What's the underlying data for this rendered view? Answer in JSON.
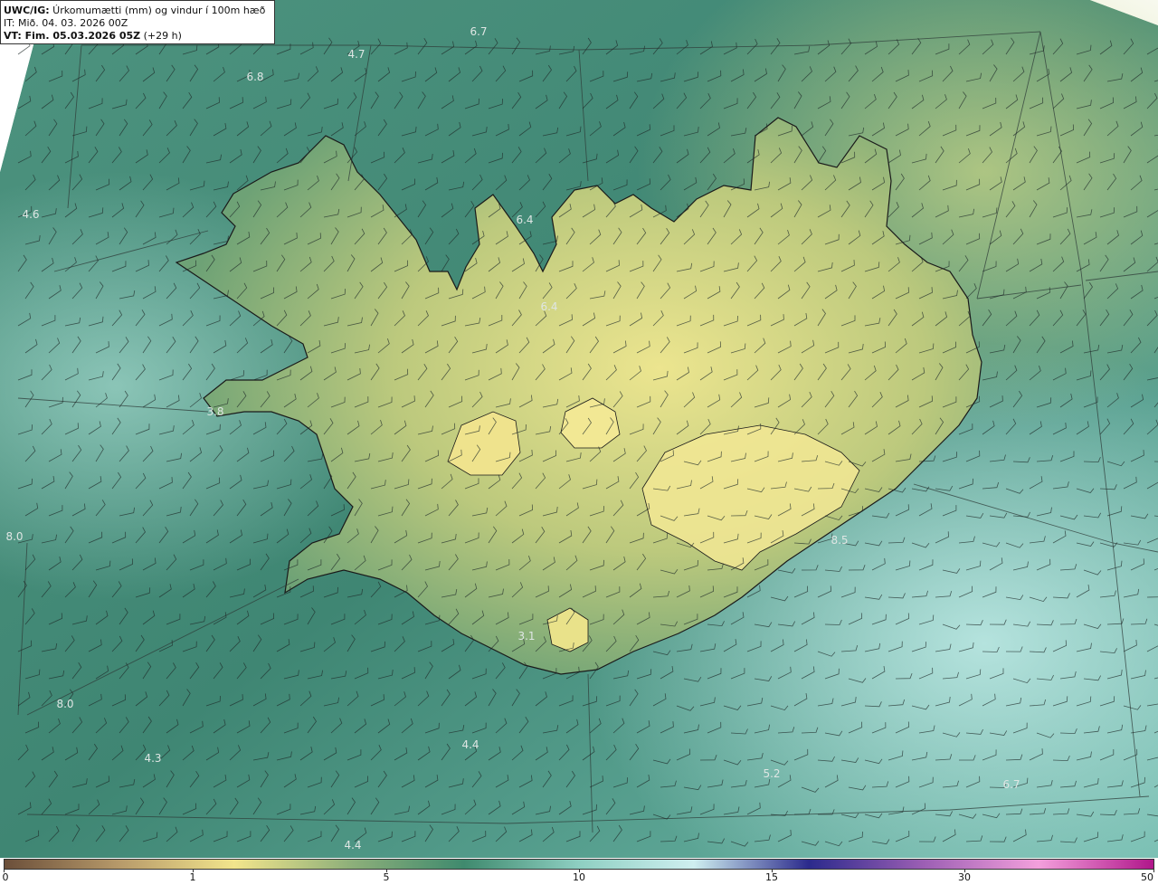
{
  "header": {
    "product_bold": "UWC/IG:",
    "product_text": " Úrkomumætti (mm) og vindur í 100m hæð",
    "init_text": "IT: Mið. 04. 03. 2026 00Z",
    "valid_bold": "VT: Fim. 05.03.2026 05Z",
    "valid_text": " (+29 h)"
  },
  "map_labels": [
    "6.7",
    "4.7",
    "6.8",
    "4.6",
    "6.4",
    "6.4",
    "3.8",
    "8.0",
    "8.0",
    "4.3",
    "4.4",
    "5.2",
    "6.7",
    "4.4",
    "3.1",
    "8.5"
  ],
  "colorbar": {
    "ticks": [
      "0",
      "1",
      "5",
      "10",
      "15",
      "30",
      "50"
    ],
    "colors": [
      "#6b4f3a",
      "#b79a6a",
      "#f2e58c",
      "#8fb07a",
      "#3f8a6e",
      "#8ecfc2",
      "#cfeff0",
      "#2b2a8c",
      "#9c5fb4",
      "#f3a0dc",
      "#b0168a"
    ]
  },
  "colors": {
    "land_light": "#e9e38a",
    "land_mid": "#9fbb72",
    "sea": "#3f8673",
    "sea_light": "#7fc0b4",
    "coast": "#1a1a1a"
  }
}
